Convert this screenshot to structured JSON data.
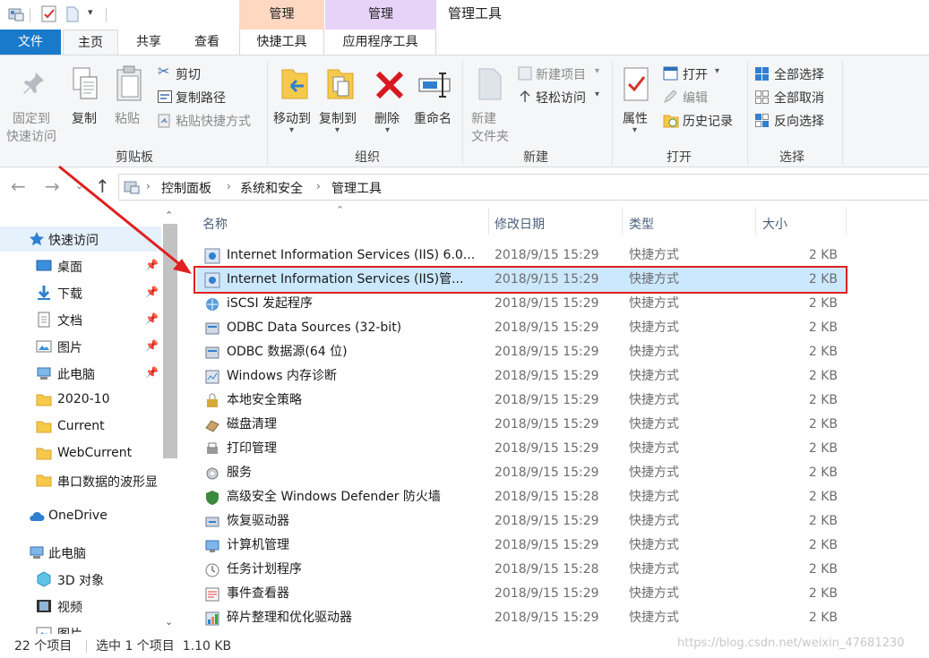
{
  "titlebar": {
    "context_tab_1": "管理",
    "context_tab_2": "管理",
    "window_title": "管理工具"
  },
  "ribbon_tabs": {
    "file": "文件",
    "home": "主页",
    "share": "共享",
    "view": "查看",
    "shortcut_tools": "快捷工具",
    "app_tools": "应用程序工具"
  },
  "ribbon": {
    "clipboard": {
      "pin_line1": "固定到",
      "pin_line2": "快速访问",
      "copy": "复制",
      "paste": "粘贴",
      "cut": "剪切",
      "copy_path": "复制路径",
      "paste_shortcut": "粘贴快捷方式",
      "group_label": "剪贴板"
    },
    "organize": {
      "move_to": "移动到",
      "copy_to": "复制到",
      "delete": "删除",
      "rename": "重命名",
      "group_label": "组织"
    },
    "new": {
      "new_folder_line1": "新建",
      "new_folder_line2": "文件夹",
      "new_item": "新建项目",
      "easy_access": "轻松访问",
      "group_label": "新建"
    },
    "open": {
      "properties": "属性",
      "open": "打开",
      "edit": "编辑",
      "history": "历史记录",
      "group_label": "打开"
    },
    "select": {
      "select_all": "全部选择",
      "select_none": "全部取消",
      "invert": "反向选择",
      "group_label": "选择"
    }
  },
  "breadcrumb": [
    "控制面板",
    "系统和安全",
    "管理工具"
  ],
  "sidebar": [
    {
      "label": "快速访问",
      "icon": "star-icon",
      "pinned": false
    },
    {
      "label": "桌面",
      "icon": "desktop-icon",
      "pinned": true
    },
    {
      "label": "下载",
      "icon": "download-icon",
      "pinned": true
    },
    {
      "label": "文档",
      "icon": "document-icon",
      "pinned": true
    },
    {
      "label": "图片",
      "icon": "picture-icon",
      "pinned": true
    },
    {
      "label": "此电脑",
      "icon": "computer-icon",
      "pinned": true
    },
    {
      "label": "2020-10",
      "icon": "folder-icon",
      "pinned": false
    },
    {
      "label": "Current",
      "icon": "folder-icon",
      "pinned": false
    },
    {
      "label": "WebCurrent",
      "icon": "folder-icon",
      "pinned": false
    },
    {
      "label": "串口数据的波形显",
      "icon": "folder-icon",
      "pinned": false
    },
    {
      "label": "OneDrive",
      "icon": "cloud-icon",
      "pinned": false
    },
    {
      "label": "此电脑",
      "icon": "computer-icon",
      "pinned": false
    },
    {
      "label": "3D 对象",
      "icon": "cube-icon",
      "pinned": false
    },
    {
      "label": "视频",
      "icon": "video-icon",
      "pinned": false
    },
    {
      "label": "图片",
      "icon": "picture-icon",
      "pinned": false
    }
  ],
  "columns": {
    "name": "名称",
    "date": "修改日期",
    "type": "类型",
    "size": "大小"
  },
  "files": [
    {
      "name": "Internet Information Services (IIS) 6.0...",
      "date": "2018/9/15 15:29",
      "type": "快捷方式",
      "size": "2 KB"
    },
    {
      "name": "Internet Information Services (IIS)管...",
      "date": "2018/9/15 15:29",
      "type": "快捷方式",
      "size": "2 KB",
      "selected": true
    },
    {
      "name": "iSCSI 发起程序",
      "date": "2018/9/15 15:29",
      "type": "快捷方式",
      "size": "2 KB"
    },
    {
      "name": "ODBC Data Sources (32-bit)",
      "date": "2018/9/15 15:29",
      "type": "快捷方式",
      "size": "2 KB"
    },
    {
      "name": "ODBC 数据源(64 位)",
      "date": "2018/9/15 15:29",
      "type": "快捷方式",
      "size": "2 KB"
    },
    {
      "name": "Windows 内存诊断",
      "date": "2018/9/15 15:29",
      "type": "快捷方式",
      "size": "2 KB"
    },
    {
      "name": "本地安全策略",
      "date": "2018/9/15 15:29",
      "type": "快捷方式",
      "size": "2 KB"
    },
    {
      "name": "磁盘清理",
      "date": "2018/9/15 15:29",
      "type": "快捷方式",
      "size": "2 KB"
    },
    {
      "name": "打印管理",
      "date": "2018/9/15 15:29",
      "type": "快捷方式",
      "size": "2 KB"
    },
    {
      "name": "服务",
      "date": "2018/9/15 15:29",
      "type": "快捷方式",
      "size": "2 KB"
    },
    {
      "name": "高级安全 Windows Defender 防火墙",
      "date": "2018/9/15 15:28",
      "type": "快捷方式",
      "size": "2 KB"
    },
    {
      "name": "恢复驱动器",
      "date": "2018/9/15 15:29",
      "type": "快捷方式",
      "size": "2 KB"
    },
    {
      "name": "计算机管理",
      "date": "2018/9/15 15:29",
      "type": "快捷方式",
      "size": "2 KB"
    },
    {
      "name": "任务计划程序",
      "date": "2018/9/15 15:28",
      "type": "快捷方式",
      "size": "2 KB"
    },
    {
      "name": "事件查看器",
      "date": "2018/9/15 15:29",
      "type": "快捷方式",
      "size": "2 KB"
    },
    {
      "name": "碎片整理和优化驱动器",
      "date": "2018/9/15 15:29",
      "type": "快捷方式",
      "size": "2 KB"
    }
  ],
  "status": {
    "count": "22 个项目",
    "selection": "选中 1 个项目  1.10 KB",
    "watermark": "https://blog.csdn.net/weixin_47681230"
  },
  "colors": {
    "file_tab": "#1979ca",
    "ctx_shortcut": "#ffd8c2",
    "ctx_app": "#e6d3f7",
    "selection": "#cce8ff",
    "highlight_box": "#e02020",
    "arrow": "#e02020"
  }
}
